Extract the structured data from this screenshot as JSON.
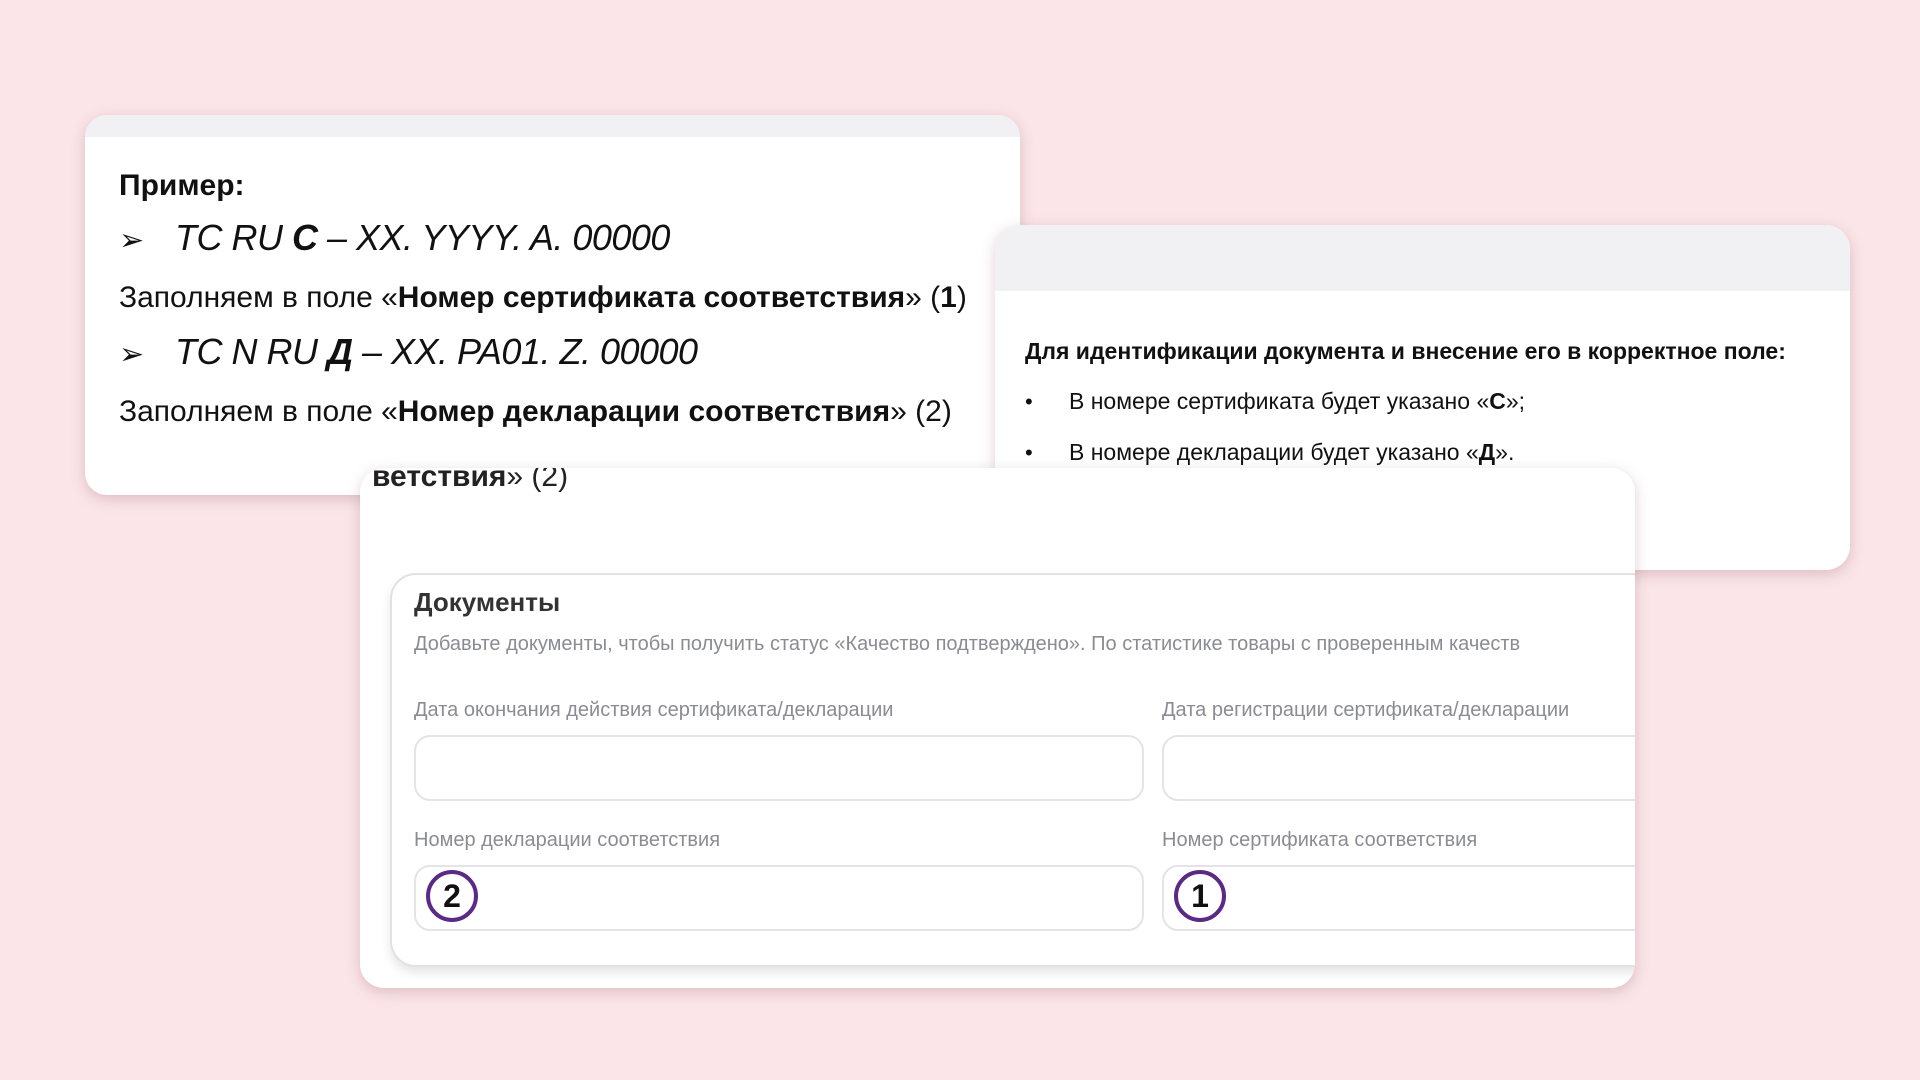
{
  "example_card": {
    "title": "Пример:",
    "code1": {
      "prefix": "TC RU ",
      "letter": "C",
      "suffix": " – XX. YYYY. A. 00000"
    },
    "fill1": {
      "before": "Заполняем в поле «",
      "field": "Номер сертификата соответствия",
      "after": "» (",
      "num": "1",
      "close": ")"
    },
    "code2": {
      "prefix": "TC N RU ",
      "letter": "Д",
      "suffix": " – XX. PA01. Z. 00000"
    },
    "fill2": {
      "before": "Заполняем в поле «",
      "field": "Номер декларации соответствия",
      "after": "» (2)"
    },
    "arrow_icon": "➢"
  },
  "ident_card": {
    "title": "Для идентификации документа и внесение его в корректное поле:",
    "items": [
      {
        "text": "В номере сертификата будет указано «",
        "letter": "С",
        "end": "»;"
      },
      {
        "text": "В номере декларации будет указано «",
        "letter": "Д",
        "end": "»."
      }
    ],
    "bullet": "•"
  },
  "docs_card": {
    "cut_text_bold": "ветствия",
    "cut_text_rest": "» (2)",
    "panel_title": "Документы",
    "description": "Добавьте документы, чтобы получить статус «Качество подтверждено». По статистике товары с проверенным качеств",
    "fields": {
      "end_date": {
        "label": "Дата окончания действия сертификата/декларации",
        "value": ""
      },
      "reg_date": {
        "label": "Дата регистрации сертификата/декларации",
        "value": ""
      },
      "declaration_number": {
        "label": "Номер декларации соответствия",
        "marker": "2"
      },
      "certificate_number": {
        "label": "Номер сертификата соответствия",
        "marker": "1"
      }
    }
  },
  "colors": {
    "background": "#fbe5e8",
    "marker_ring": "#5a2a86",
    "muted_text": "#8b8b93"
  }
}
